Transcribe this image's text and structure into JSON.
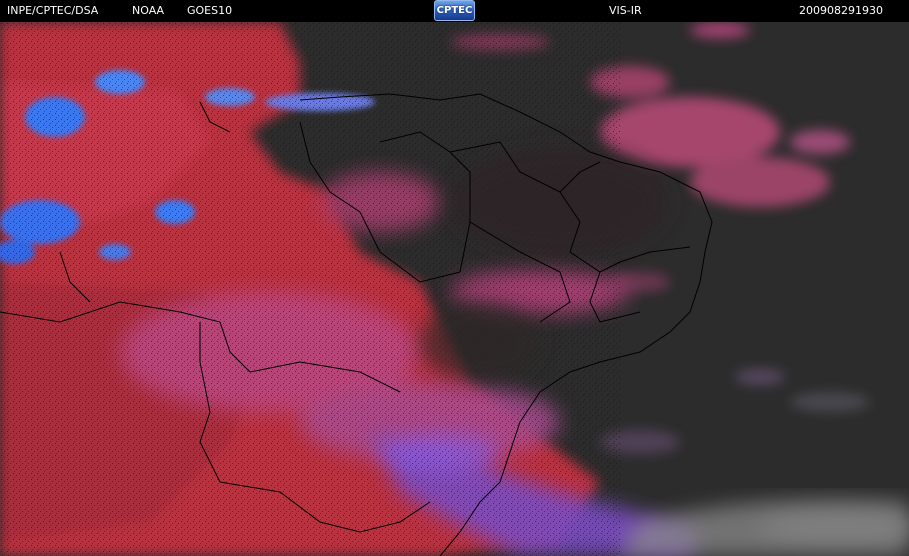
{
  "header": {
    "org": "INPE/CPTEC/DSA",
    "agency": "NOAA",
    "satellite": "GOES10",
    "channel": "VIS-IR",
    "timestamp": "200908291930"
  },
  "logo": {
    "text": "CPTEC",
    "color": "#2a5db8"
  },
  "colors": {
    "background_ocean": "#2c2c2c",
    "cloud_red": "#c8334a",
    "cloud_magenta": "#b53d78",
    "cloud_violet": "#8a4fc8",
    "cold_cloud_blue": "#3a78f0",
    "low_cloud_gray": "#8a8a8a",
    "borders": "#000000"
  }
}
